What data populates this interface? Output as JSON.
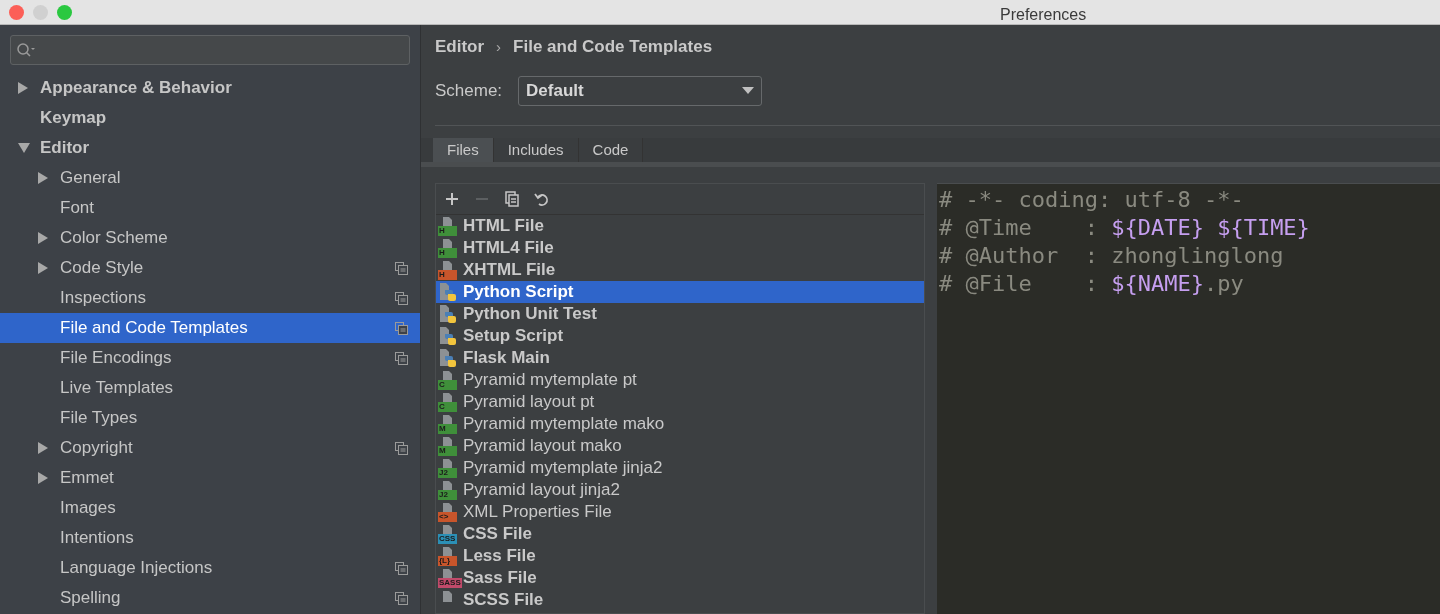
{
  "window": {
    "title": "Preferences"
  },
  "sidebar": {
    "items": [
      {
        "label": "Appearance & Behavior",
        "kind": "collapsed",
        "selected": false,
        "project_icon": false
      },
      {
        "label": "Keymap",
        "kind": "leaf",
        "selected": false,
        "project_icon": false
      },
      {
        "label": "Editor",
        "kind": "expanded",
        "selected": false,
        "project_icon": false,
        "children": [
          {
            "label": "General",
            "kind": "collapsed",
            "selected": false,
            "project_icon": false
          },
          {
            "label": "Font",
            "kind": "leaf",
            "selected": false,
            "project_icon": false
          },
          {
            "label": "Color Scheme",
            "kind": "collapsed",
            "selected": false,
            "project_icon": false
          },
          {
            "label": "Code Style",
            "kind": "collapsed",
            "selected": false,
            "project_icon": true
          },
          {
            "label": "Inspections",
            "kind": "leaf",
            "selected": false,
            "project_icon": true
          },
          {
            "label": "File and Code Templates",
            "kind": "leaf",
            "selected": true,
            "project_icon": true
          },
          {
            "label": "File Encodings",
            "kind": "leaf",
            "selected": false,
            "project_icon": true
          },
          {
            "label": "Live Templates",
            "kind": "leaf",
            "selected": false,
            "project_icon": false
          },
          {
            "label": "File Types",
            "kind": "leaf",
            "selected": false,
            "project_icon": false
          },
          {
            "label": "Copyright",
            "kind": "collapsed",
            "selected": false,
            "project_icon": true
          },
          {
            "label": "Emmet",
            "kind": "collapsed",
            "selected": false,
            "project_icon": false
          },
          {
            "label": "Images",
            "kind": "leaf",
            "selected": false,
            "project_icon": false
          },
          {
            "label": "Intentions",
            "kind": "leaf",
            "selected": false,
            "project_icon": false
          },
          {
            "label": "Language Injections",
            "kind": "leaf",
            "selected": false,
            "project_icon": true
          },
          {
            "label": "Spelling",
            "kind": "leaf",
            "selected": false,
            "project_icon": true
          }
        ]
      }
    ]
  },
  "breadcrumb": [
    "Editor",
    "›",
    "File and Code Templates"
  ],
  "scheme": {
    "label": "Scheme:",
    "value": "Default"
  },
  "tabs": [
    {
      "label": "Files",
      "selected": true
    },
    {
      "label": "Includes",
      "selected": false
    },
    {
      "label": "Code",
      "selected": false
    }
  ],
  "toolbar": [
    {
      "kind": "add",
      "disabled": false
    },
    {
      "kind": "remove",
      "disabled": true
    },
    {
      "kind": "copy",
      "disabled": false
    },
    {
      "kind": "reset",
      "disabled": false
    }
  ],
  "templates": [
    {
      "label": "HTML File",
      "bold": true,
      "selected": false,
      "kind": "file",
      "badge": "H",
      "color": "#3f8f3a"
    },
    {
      "label": "HTML4 File",
      "bold": true,
      "selected": false,
      "kind": "file",
      "badge": "H",
      "color": "#3f8f3a"
    },
    {
      "label": "XHTML File",
      "bold": true,
      "selected": false,
      "kind": "file",
      "badge": "H",
      "color": "#c8552b"
    },
    {
      "label": "Python Script",
      "bold": true,
      "selected": true,
      "kind": "python"
    },
    {
      "label": "Python Unit Test",
      "bold": true,
      "selected": false,
      "kind": "python"
    },
    {
      "label": "Setup Script",
      "bold": true,
      "selected": false,
      "kind": "python"
    },
    {
      "label": "Flask Main",
      "bold": true,
      "selected": false,
      "kind": "python"
    },
    {
      "label": "Pyramid mytemplate pt",
      "bold": false,
      "selected": false,
      "kind": "file",
      "badge": "C",
      "color": "#3f8f3a"
    },
    {
      "label": "Pyramid layout pt",
      "bold": false,
      "selected": false,
      "kind": "file",
      "badge": "C",
      "color": "#3f8f3a"
    },
    {
      "label": "Pyramid mytemplate mako",
      "bold": false,
      "selected": false,
      "kind": "file",
      "badge": "M",
      "color": "#3f8f3a"
    },
    {
      "label": "Pyramid layout mako",
      "bold": false,
      "selected": false,
      "kind": "file",
      "badge": "M",
      "color": "#3f8f3a"
    },
    {
      "label": "Pyramid mytemplate jinja2",
      "bold": false,
      "selected": false,
      "kind": "file",
      "badge": "J2",
      "color": "#3f8f3a"
    },
    {
      "label": "Pyramid layout jinja2",
      "bold": false,
      "selected": false,
      "kind": "file",
      "badge": "J2",
      "color": "#3f8f3a"
    },
    {
      "label": "XML Properties File",
      "bold": false,
      "selected": false,
      "kind": "file",
      "badge": "<>",
      "color": "#c8552b"
    },
    {
      "label": "CSS File",
      "bold": true,
      "selected": false,
      "kind": "file",
      "badge": "CSS",
      "color": "#2b8fb5"
    },
    {
      "label": "Less File",
      "bold": true,
      "selected": false,
      "kind": "file",
      "badge": "{L}",
      "color": "#c8552b"
    },
    {
      "label": "Sass File",
      "bold": true,
      "selected": false,
      "kind": "file",
      "badge": "SASS",
      "color": "#c04a6a"
    },
    {
      "label": "SCSS File",
      "bold": true,
      "selected": false,
      "kind": "file"
    }
  ],
  "code_lines": [
    [
      {
        "text": "# -*- coding: utf-8 -*-",
        "kind": "comment"
      }
    ],
    [
      {
        "text": "# @Time    : ",
        "kind": "comment"
      },
      {
        "text": "${DATE} ${TIME}",
        "kind": "variable"
      }
    ],
    [
      {
        "text": "# @Author  : zhonglinglong",
        "kind": "comment"
      }
    ],
    [
      {
        "text": "# @File    : ",
        "kind": "comment"
      },
      {
        "text": "${NAME}",
        "kind": "variable"
      },
      {
        "text": ".py",
        "kind": "comment"
      }
    ]
  ]
}
